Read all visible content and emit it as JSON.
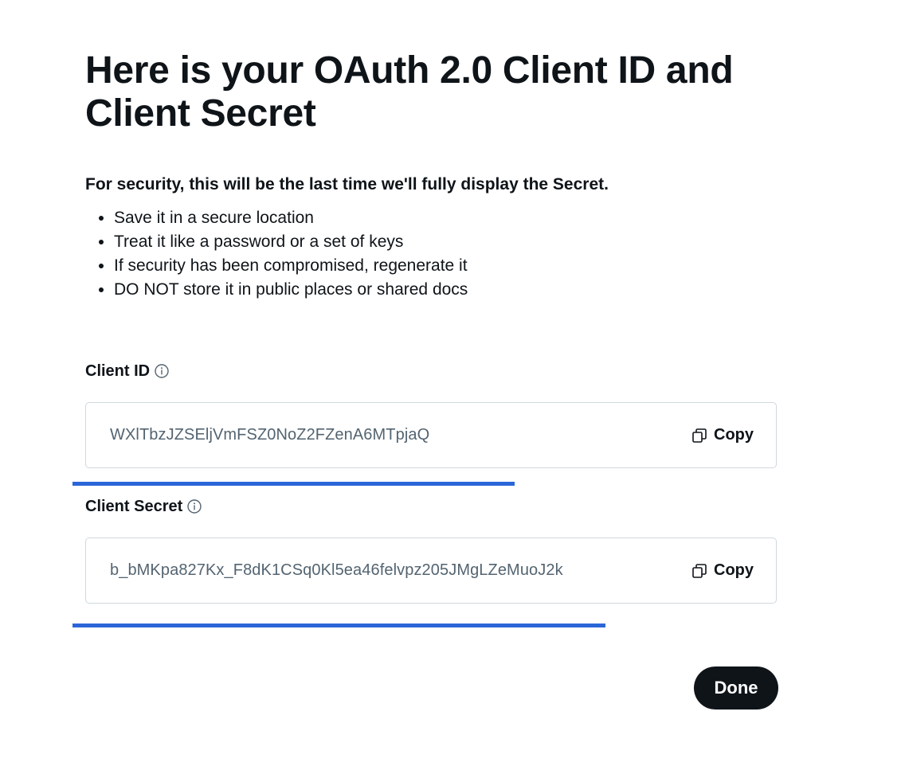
{
  "title": "Here is your OAuth 2.0 Client ID and Client Secret",
  "notice": "For security, this will be the last time we'll fully display the Secret.",
  "tips": [
    "Save it in a secure location",
    "Treat it like a password or a set of keys",
    "If security has been compromised, regenerate it",
    "DO NOT store it in public places or shared docs"
  ],
  "client_id": {
    "label": "Client ID",
    "info_icon": "info-circle-icon",
    "value": "WXlTbzJZSEljVmFSZ0NoZ2FZenA6MTpjaQ",
    "copy_label": "Copy",
    "copy_icon": "copy-icon"
  },
  "client_secret": {
    "label": "Client Secret",
    "info_icon": "info-circle-icon",
    "value": "b_bMKpa827Kx_F8dK1CSq0Kl5ea46felvpz205JMgLZeMuoJ2k",
    "copy_label": "Copy",
    "copy_icon": "copy-icon"
  },
  "done_label": "Done",
  "colors": {
    "text": "#0f1419",
    "secondary_text": "#536471",
    "border": "#cfd9de",
    "underline": "#2b66d9",
    "button_bg": "#0f1419",
    "button_text": "#ffffff"
  }
}
